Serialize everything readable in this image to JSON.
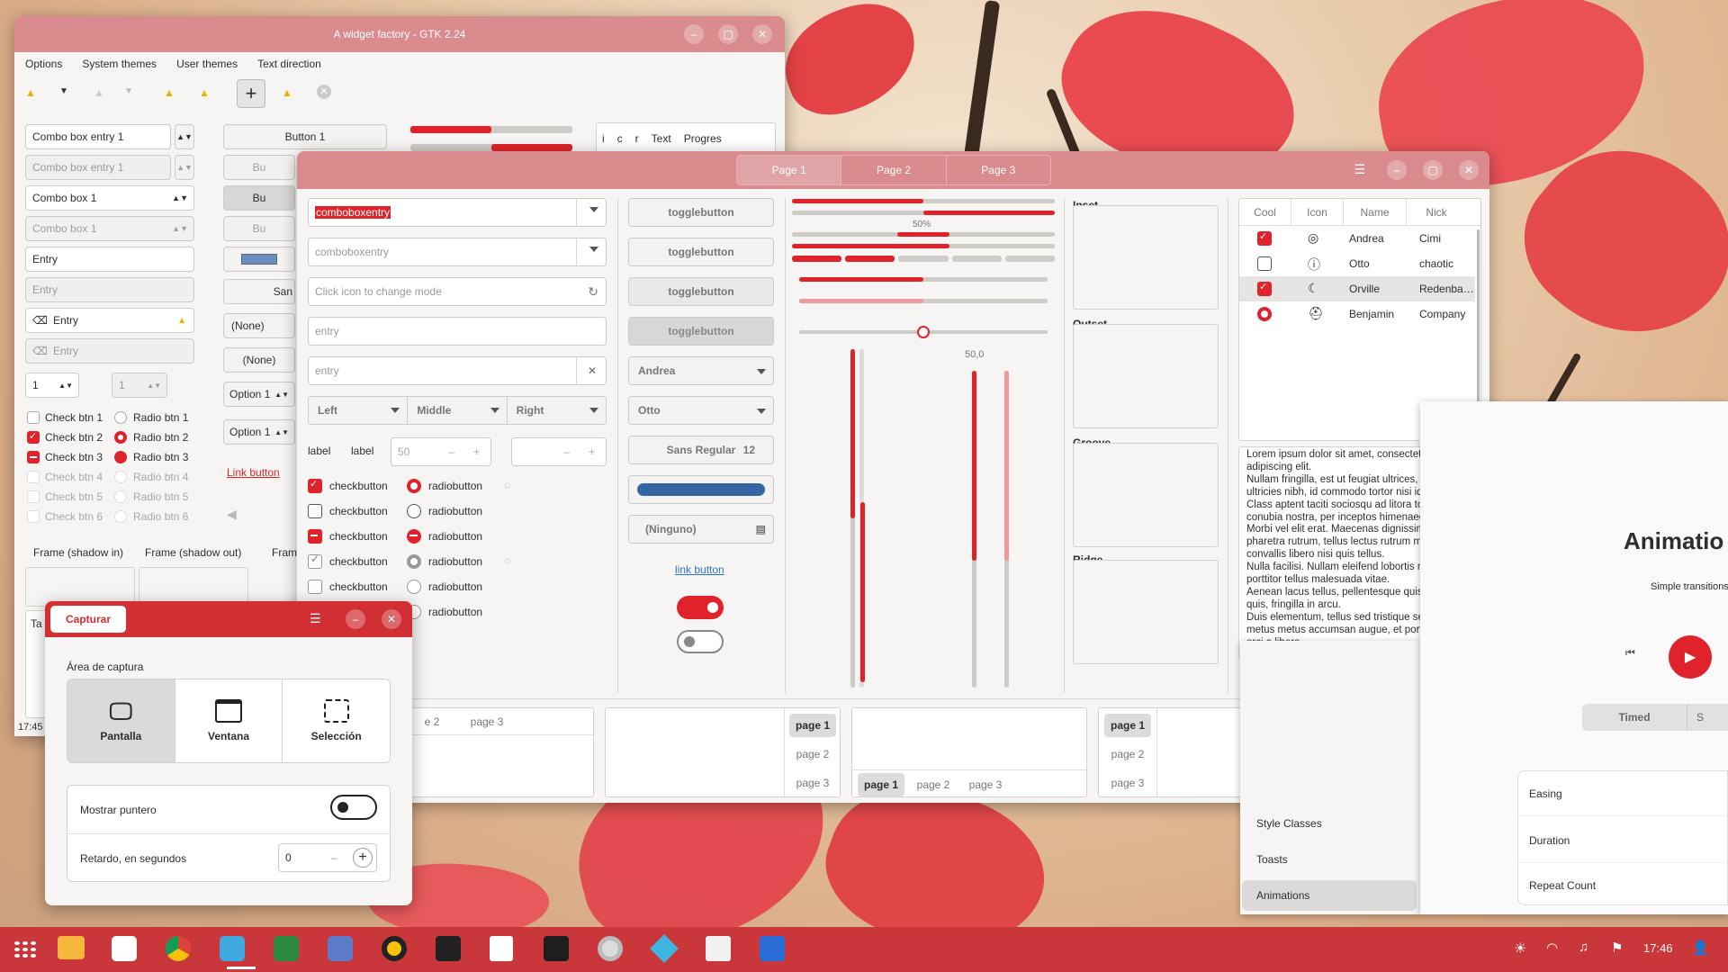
{
  "colors": {
    "accent": "#e0232b",
    "titlebar": "#d98b8d",
    "taskbar": "#c9373b"
  },
  "wf": {
    "title": "A widget factory - GTK 2.24",
    "menu": [
      "Options",
      "System themes",
      "User themes",
      "Text direction"
    ],
    "left": {
      "combo_entry_1": "Combo box entry 1",
      "combo_entry_1_dis": "Combo box entry 1",
      "combo_1": "Combo box 1",
      "combo_1_dis": "Combo box 1",
      "entry": "Entry",
      "entry_dis": "Entry",
      "entry_icon": "Entry",
      "entry_icon_dis": "Entry",
      "spin": "1",
      "spin_dis": "1",
      "checks": [
        "Check btn 1",
        "Check btn 2",
        "Check btn 3",
        "Check btn 4",
        "Check btn 5",
        "Check btn 6"
      ],
      "radios": [
        "Radio btn 1",
        "Radio btn 2",
        "Radio btn 3",
        "Radio btn 4",
        "Radio btn 5",
        "Radio btn 6"
      ],
      "frame_in": "Frame (shadow in)",
      "frame_out": "Frame (shadow out)",
      "frame_cut": "Fram",
      "textview_cut": "Ta",
      "time": "17:45"
    },
    "mid": {
      "button1": "Button 1",
      "bu": "Bu",
      "sans": "San",
      "none1": "(None)",
      "none2": "(None)",
      "option1a": "Option 1",
      "option1b": "Option 1",
      "link": "Link button"
    },
    "tree_headers": [
      "i",
      "c",
      "r",
      "Text",
      "Progres"
    ]
  },
  "g3": {
    "tabs": [
      "Page 1",
      "Page 2",
      "Page 3"
    ],
    "c1": {
      "combo_sel": "comboboxentry",
      "combo2": "comboboxentry",
      "mode_placeholder": "Click icon to change mode",
      "entry1": "entry",
      "entry2": "entry",
      "seg": [
        "Left",
        "Middle",
        "Right"
      ],
      "label1": "label",
      "label2": "label",
      "spin_a": "50",
      "checks": [
        "checkbutton",
        "checkbutton",
        "checkbutton",
        "checkbutton",
        "checkbutton"
      ],
      "radios": [
        "radiobutton",
        "radiobutton",
        "radiobutton",
        "radiobutton",
        "radiobutton",
        "radiobutton"
      ]
    },
    "c2": {
      "toggles": [
        "togglebutton",
        "togglebutton",
        "togglebutton",
        "togglebutton"
      ],
      "combo_a": "Andrea",
      "combo_b": "Otto",
      "font": "Sans Regular",
      "font_size": "12",
      "file": "(Ninguno)",
      "link": "link button"
    },
    "c3": {
      "percent": "50%",
      "scale_val": "50,0",
      "scale_val2": "50,0",
      "progress": [
        0.5,
        0.5,
        0.6,
        0.4
      ],
      "vbars": [
        0.7,
        0.6,
        0.5,
        0.5
      ]
    },
    "c4": {
      "frames": [
        "Inset",
        "Outset",
        "Groove",
        "Ridge"
      ]
    },
    "list": {
      "headers": [
        "Cool",
        "Icon",
        "Name",
        "Nick"
      ],
      "rows": [
        {
          "name": "Andrea",
          "nick": "Cimi",
          "icon": "check-circle-icon"
        },
        {
          "name": "Otto",
          "nick": "chaotic",
          "icon": "exclamation-circle-icon"
        },
        {
          "name": "Orville",
          "nick": "Redenba…",
          "icon": "moon-icon"
        },
        {
          "name": "Benjamin",
          "nick": "Company",
          "icon": "cap-icon"
        }
      ]
    },
    "text": "Lorem ipsum dolor sit amet, consectetur adipiscing elit.\nNullam fringilla, est ut feugiat ultrices, elit lacus ultricies nibh, id commodo tortor nisi id elit.\nClass aptent taciti sociosqu ad litora torquent per conubia nostra, per inceptos himenaeos.\nMorbi vel elit erat. Maecenas dignissim, dui et pharetra rutrum, tellus lectus rutrum mi, a convallis libero nisi quis tellus.\nNulla facilisi. Nullam eleifend lobortis nisl, in porttitor tellus malesuada vitae.\nAenean lacus tellus, pellentesque quis molestie quis, fringilla in arcu.\nDuis elementum, tellus sed tristique semper, metus metus accumsan augue, et porttitor augue orci a libero.",
    "nb": {
      "p1": "page 1",
      "p2": "page 2",
      "p3": "page 3",
      "p2b": "e 2"
    }
  },
  "cap": {
    "title": "Capturar",
    "area_label": "Área de captura",
    "modes": [
      "Pantalla",
      "Ventana",
      "Selección"
    ],
    "pointer": "Mostrar puntero",
    "delay": "Retardo, en segundos",
    "delay_val": "0"
  },
  "side": {
    "heading": "Animatio",
    "sub": "Simple transitions",
    "timed": "Timed",
    "s": "S",
    "nav": [
      "Style Classes",
      "Toasts",
      "Animations"
    ],
    "props": [
      "Easing",
      "Duration",
      "Repeat Count"
    ]
  },
  "taskbar": {
    "clock": "17:46"
  }
}
